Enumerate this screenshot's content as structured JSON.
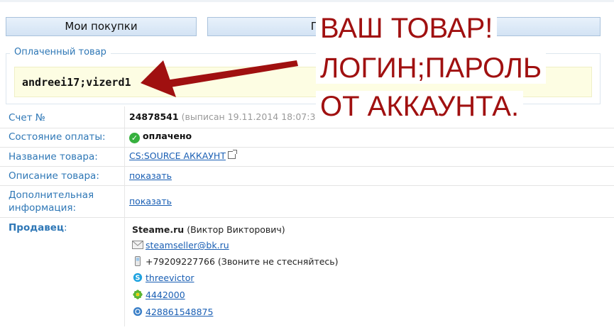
{
  "tabs": [
    {
      "label": "Мои покупки"
    },
    {
      "label": "Промо-коды / Подарочные карты"
    }
  ],
  "paid_section": {
    "legend": "Оплаченный товар",
    "content": "andreei17;vizerd1"
  },
  "details": {
    "invoice": {
      "label": "Счет №",
      "number": "24878541",
      "meta": "(выписан 19.11.2014 18:07:32 на сумму 35 RUR"
    },
    "payment_status": {
      "label": "Состояние оплаты:",
      "value": "оплачено"
    },
    "product_name": {
      "label": "Название товара:",
      "value": "CS:SOURCE АККАУНТ"
    },
    "product_description": {
      "label": "Описание товара:",
      "link": "показать"
    },
    "extra_info": {
      "label_line1": "Дополнительная",
      "label_line2": "информация:",
      "link": "показать"
    }
  },
  "seller": {
    "label": "Продавец",
    "colon": ":",
    "name": "Steame.ru",
    "person": "(Виктор Викторович)",
    "email": "steamseller@bk.ru",
    "phone": "+79209227766 (Звоните не стесняйтесь)",
    "skype": "threevictor",
    "icq": "4442000",
    "wmid": "428861548875"
  },
  "overlay_text": {
    "line1": "ВАШ ТОВАР!",
    "line2": "ЛОГИН;ПАРОЛЬ",
    "line3": "ОТ АККАУНТА."
  },
  "colors": {
    "overlay_red": "#a01010",
    "link_blue": "#2e77b6",
    "goods_bg": "#fdfde3",
    "status_green": "#36b03e"
  },
  "icons": [
    "check-icon",
    "external-link-icon",
    "envelope-icon",
    "phone-icon",
    "skype-icon",
    "icq-icon",
    "webmoney-icon",
    "arrow-icon"
  ]
}
